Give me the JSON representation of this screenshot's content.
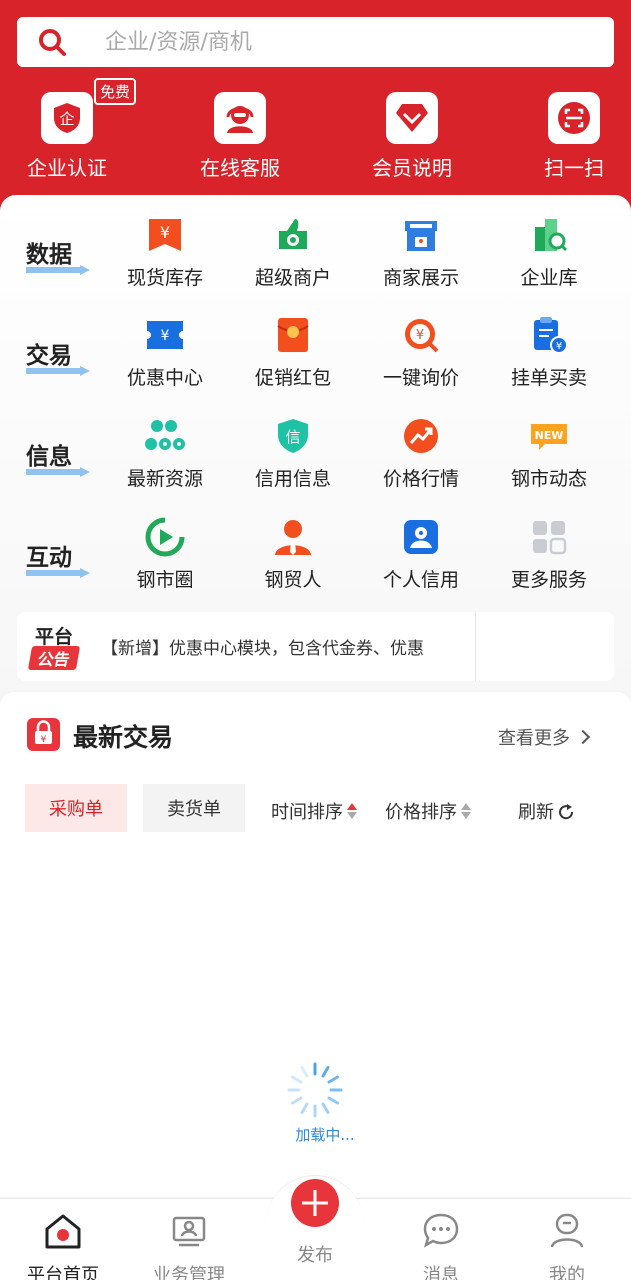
{
  "colors": {
    "brand_red": "#d9232a",
    "loading_blue": "#2a8be0"
  },
  "search": {
    "placeholder": "企业/资源/商机"
  },
  "quick_actions": [
    {
      "label": "企业认证",
      "icon": "certify-icon",
      "badge": "免费"
    },
    {
      "label": "在线客服",
      "icon": "customer-service-icon"
    },
    {
      "label": "会员说明",
      "icon": "diamond-icon"
    },
    {
      "label": "扫一扫",
      "icon": "scan-icon"
    }
  ],
  "categories": [
    {
      "name": "数据",
      "items": [
        {
          "label": "现货库存",
          "icon": "inventory-icon"
        },
        {
          "label": "超级商户",
          "icon": "super-merchant-icon"
        },
        {
          "label": "商家展示",
          "icon": "store-icon"
        },
        {
          "label": "企业库",
          "icon": "enterprise-library-icon"
        }
      ]
    },
    {
      "name": "交易",
      "items": [
        {
          "label": "优惠中心",
          "icon": "coupon-icon"
        },
        {
          "label": "促销红包",
          "icon": "red-packet-icon"
        },
        {
          "label": "一键询价",
          "icon": "inquiry-icon"
        },
        {
          "label": "挂单买卖",
          "icon": "order-icon"
        }
      ]
    },
    {
      "name": "信息",
      "items": [
        {
          "label": "最新资源",
          "icon": "resources-icon"
        },
        {
          "label": "信用信息",
          "icon": "credit-shield-icon",
          "icon_text": "信"
        },
        {
          "label": "价格行情",
          "icon": "trend-icon"
        },
        {
          "label": "钢市动态",
          "icon": "new-badge-icon",
          "icon_text": "NEW"
        }
      ]
    },
    {
      "name": "互动",
      "items": [
        {
          "label": "钢市圈",
          "icon": "circle-play-icon"
        },
        {
          "label": "钢贸人",
          "icon": "person-icon"
        },
        {
          "label": "个人信用",
          "icon": "personal-credit-icon"
        },
        {
          "label": "更多服务",
          "icon": "grid-icon"
        }
      ]
    }
  ],
  "notice": {
    "tag_top": "平台",
    "tag_bottom": "公告",
    "text": "【新增】优惠中心模块，包含代金券、优惠"
  },
  "trades": {
    "title": "最新交易",
    "more_label": "查看更多",
    "tabs": [
      {
        "label": "采购单",
        "active": true
      },
      {
        "label": "卖货单",
        "active": false
      }
    ],
    "sort_time": "时间排序",
    "sort_price": "价格排序",
    "refresh": "刷新",
    "loading": "加载中..."
  },
  "nav": {
    "items": [
      {
        "label": "平台首页",
        "icon": "home-icon",
        "active": true
      },
      {
        "label": "业务管理",
        "icon": "business-icon",
        "active": false
      },
      {
        "label": "发布",
        "icon": "plus-icon",
        "active": false
      },
      {
        "label": "消息",
        "icon": "message-icon",
        "active": false
      },
      {
        "label": "我的",
        "icon": "profile-icon",
        "active": false
      }
    ]
  }
}
